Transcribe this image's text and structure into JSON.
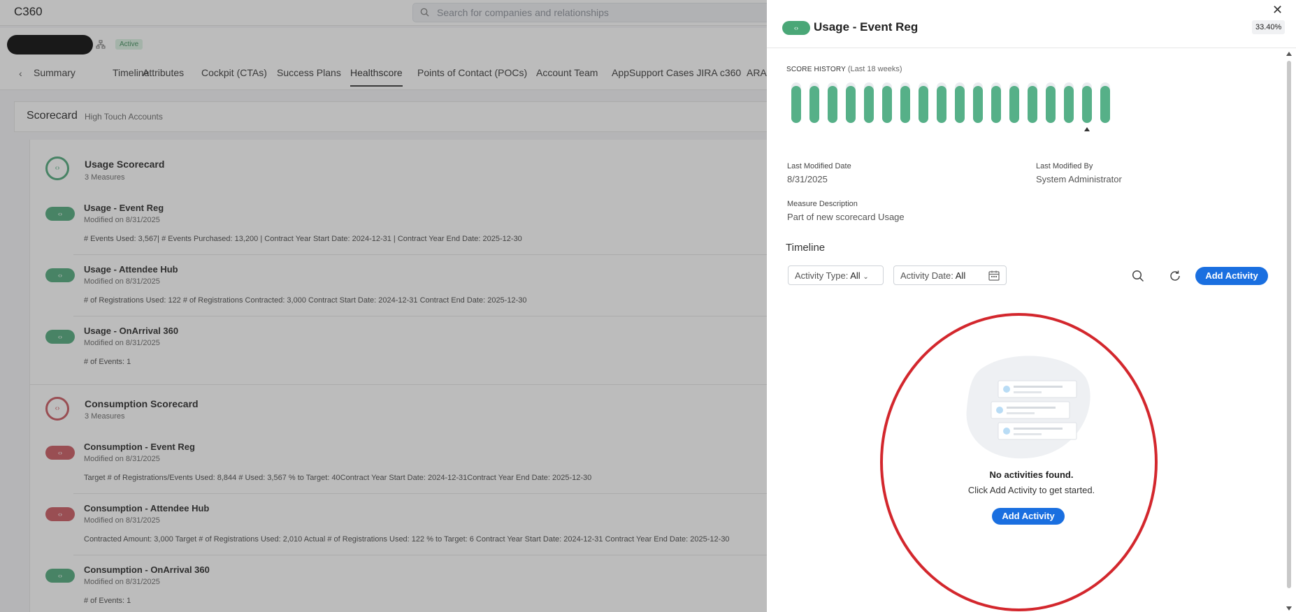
{
  "app": {
    "title": "C360",
    "search_placeholder": "Search for companies and relationships",
    "status_badge": "Active"
  },
  "tabs": [
    {
      "label": "Summary"
    },
    {
      "label": "Timeline"
    },
    {
      "label": "Attributes"
    },
    {
      "label": "Cockpit (CTAs)"
    },
    {
      "label": "Success Plans"
    },
    {
      "label": "Healthscore",
      "selected": true
    },
    {
      "label": "Points of Contact (POCs)"
    },
    {
      "label": "Account Team"
    },
    {
      "label": "AppSupport Cases JIRA c360"
    },
    {
      "label": "ARA"
    }
  ],
  "scorecard": {
    "title": "Scorecard",
    "subtitle": "High Touch Accounts"
  },
  "groups": [
    {
      "title": "Usage Scorecard",
      "measures_count": "3 Measures",
      "status": "green",
      "measures": [
        {
          "title": "Usage - Event Reg",
          "modified": "Modified on  8/31/2025",
          "detail": "# Events Used: 3,567| # Events Purchased: 13,200 | Contract Year Start Date: 2024-12-31 | Contract Year End Date: 2025-12-30",
          "status": "green"
        },
        {
          "title": "Usage - Attendee Hub",
          "modified": "Modified on  8/31/2025",
          "detail": "# of Registrations Used: 122 # of Registrations Contracted: 3,000 Contract Start Date: 2024-12-31 Contract End Date: 2025-12-30",
          "status": "green"
        },
        {
          "title": "Usage - OnArrival 360",
          "modified": "Modified on  8/31/2025",
          "detail": "# of Events: 1",
          "status": "green"
        }
      ]
    },
    {
      "title": "Consumption Scorecard",
      "measures_count": "3 Measures",
      "status": "red",
      "measures": [
        {
          "title": "Consumption - Event Reg",
          "modified": "Modified on  8/31/2025",
          "detail": "Target # of Registrations/Events Used: 8,844 # Used: 3,567 % to Target: 40Contract Year Start Date: 2024-12-31Contract Year End Date: 2025-12-30",
          "status": "red"
        },
        {
          "title": "Consumption - Attendee Hub",
          "modified": "Modified on  8/31/2025",
          "detail": "Contracted Amount: 3,000 Target # of Registrations Used: 2,010 Actual # of Registrations Used: 122 % to Target: 6 Contract Year Start Date: 2024-12-31 Contract Year End Date: 2025-12-30",
          "status": "red"
        },
        {
          "title": "Consumption - OnArrival 360",
          "modified": "Modified on  8/31/2025",
          "detail": "# of Events: 1",
          "status": "green"
        }
      ]
    }
  ],
  "panel": {
    "title": "Usage - Event Reg",
    "percent": "33.40%",
    "score_history_label": "SCORE HISTORY",
    "score_history_range": "(Last 18 weeks)",
    "score_history_weeks": 18,
    "score_history_fill": [
      0.91,
      0.91,
      0.91,
      0.91,
      0.91,
      0.91,
      0.91,
      0.91,
      0.91,
      0.91,
      0.91,
      0.91,
      0.91,
      0.91,
      0.91,
      0.91,
      0.91,
      0.91
    ],
    "selected_week_index": 16,
    "last_modified_date_label": "Last Modified Date",
    "last_modified_date": "8/31/2025",
    "last_modified_by_label": "Last Modified By",
    "last_modified_by": "System Administrator",
    "measure_description_label": "Measure Description",
    "measure_description": "Part of new scorecard Usage",
    "timeline_heading": "Timeline",
    "activity_type_label": "Activity Type:",
    "activity_type_value": "All",
    "activity_date_label": "Activity Date:",
    "activity_date_value": "All",
    "add_activity_label": "Add Activity",
    "empty_title": "No activities found.",
    "empty_subtitle": "Click Add Activity to get started.",
    "empty_button_label": "Add Activity"
  },
  "icons": {
    "close": "close-icon",
    "search": "search-icon",
    "refresh": "refresh-icon",
    "calendar": "calendar-icon",
    "hierarchy": "hierarchy-icon"
  },
  "colors": {
    "good": "#4aa777",
    "bad": "#c9535c",
    "primary": "#1a6fe0",
    "annotation": "#d3272d"
  }
}
